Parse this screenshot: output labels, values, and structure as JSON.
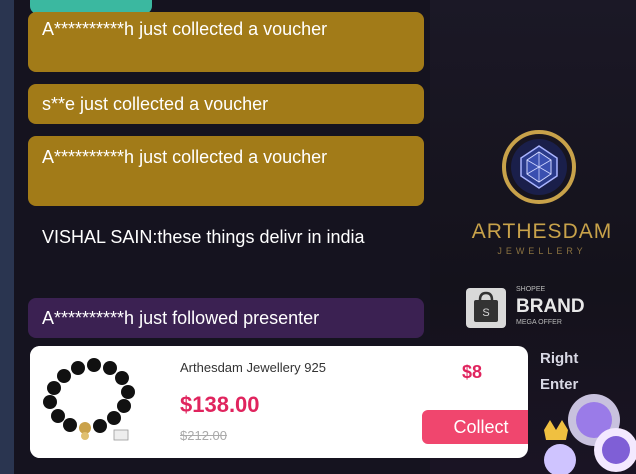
{
  "chat": {
    "messages": [
      {
        "text": "A**********h just collected a voucher",
        "style": "gold"
      },
      {
        "text": "s**e just collected a voucher",
        "style": "gold"
      },
      {
        "text": "A**********h just collected a voucher",
        "style": "gold"
      },
      {
        "text": "VISHAL SAIN:these things delivr in india",
        "style": "plain"
      },
      {
        "text": "A**********h just followed presenter",
        "style": "purple"
      }
    ]
  },
  "brand": {
    "name": "ARTHESDAM",
    "subtitle": "JEWELLERY",
    "badge_top": "SHOPEE",
    "badge_text": "BRAND",
    "badge_bottom": "MEGA OFFER"
  },
  "side_text": {
    "line1": "Right",
    "line2": "Enter"
  },
  "product": {
    "name": "Arthesdam Jewellery 925",
    "price": "$138.00",
    "original_price": "$212.00",
    "discount": "$8",
    "collect_label": "Collect"
  },
  "colors": {
    "voucher_bg": "#a27b18",
    "follow_bg": "#3b2152",
    "price": "#e0245e",
    "collect_button": "#f0466e",
    "brand_gold": "#c8a24a"
  },
  "icons": [
    "diamond-logo-icon",
    "shopping-bag-icon",
    "bracelet-thumbnail-icon",
    "viewer-avatar-icon"
  ]
}
